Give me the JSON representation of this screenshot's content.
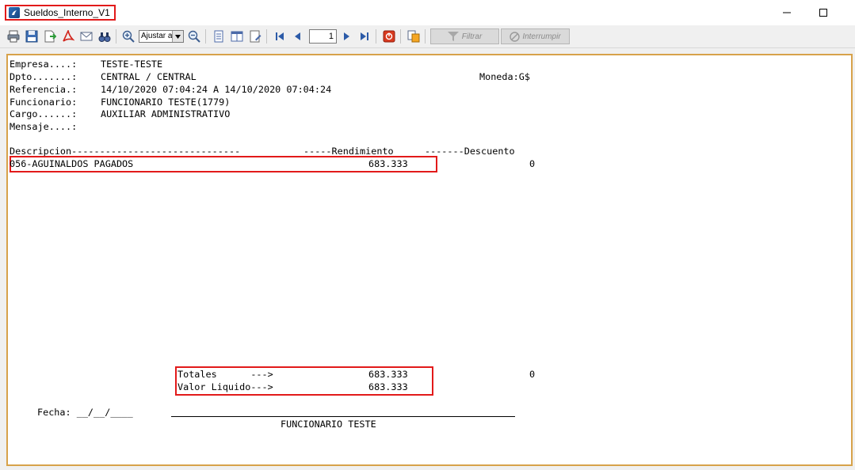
{
  "window": {
    "title": "Sueldos_Interno_V1"
  },
  "toolbar": {
    "zoom_value": "Ajustar a",
    "page_number": "1",
    "filter_label": "Filtrar",
    "interrupt_label": "Interrumpir"
  },
  "report": {
    "empresa_label": "Empresa....:",
    "empresa_value": "TESTE-TESTE",
    "dpto_label": "Dpto.......:",
    "dpto_value": "CENTRAL / CENTRAL",
    "moneda": "Moneda:G$",
    "referencia_label": "Referencia.:",
    "referencia_value": "14/10/2020 07:04:24 A 14/10/2020 07:04:24",
    "funcionario_label": "Funcionario:",
    "funcionario_value": "FUNCIONARIO TESTE(1779)",
    "cargo_label": "Cargo......:",
    "cargo_value": "AUXILIAR ADMINISTRATIVO",
    "mensaje_label": "Mensaje....:",
    "columns": {
      "descripcion": "Descripcion------------------------------",
      "rendimiento": "-----Rendimiento",
      "descuento": "-------Descuento"
    },
    "rows": [
      {
        "descripcion": "056-AGUINALDOS PAGADOS",
        "rendimiento": "683.333",
        "descuento": "0"
      }
    ],
    "totales": {
      "label": "Totales      --->",
      "rendimiento": "683.333",
      "descuento": "0"
    },
    "liquido": {
      "label": "Valor Liquido--->",
      "rendimiento": "683.333"
    },
    "fecha": "Fecha: __/__/____",
    "signature_name": "FUNCIONARIO TESTE"
  }
}
